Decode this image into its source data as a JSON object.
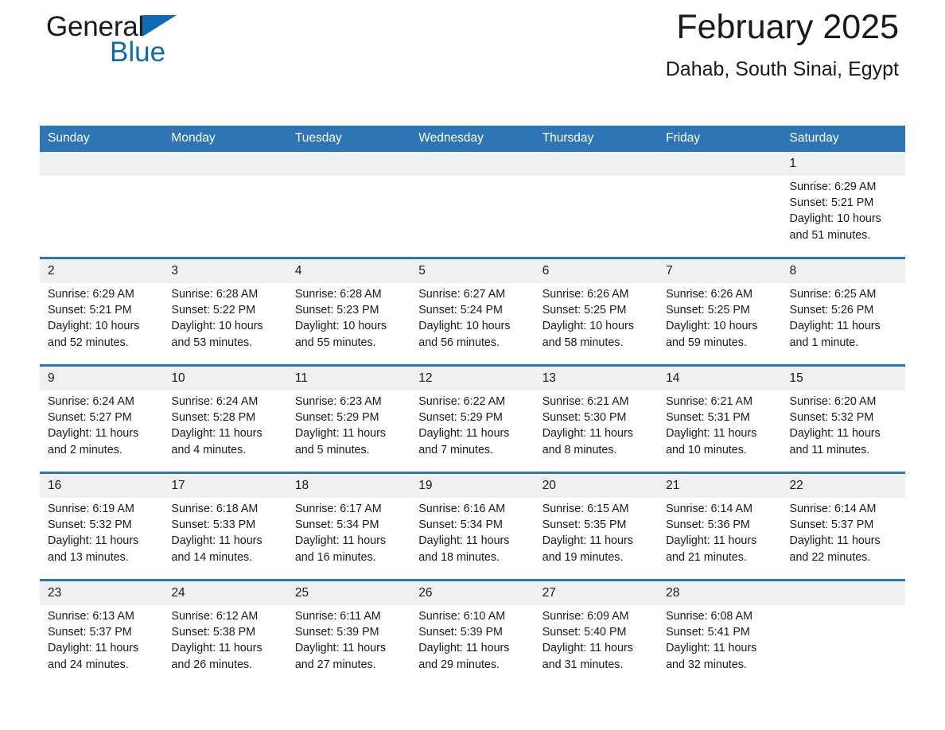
{
  "logo": {
    "word1": "General",
    "word2": "Blue",
    "triangle_color": "#1069b4",
    "triangle_icon": "triangle-icon"
  },
  "header": {
    "title": "February 2025",
    "subtitle": "Dahab, South Sinai, Egypt"
  },
  "colors": {
    "header_blue": "#2e75b6",
    "daynum_band": "#f0f0f0",
    "text": "#1a1a1a",
    "logo_blue": "#1069b4"
  },
  "calendar": {
    "weekday_headers": [
      "Sunday",
      "Monday",
      "Tuesday",
      "Wednesday",
      "Thursday",
      "Friday",
      "Saturday"
    ],
    "weeks": [
      [
        {
          "day": "",
          "sunrise": "",
          "sunset": "",
          "daylight": "",
          "empty": true
        },
        {
          "day": "",
          "sunrise": "",
          "sunset": "",
          "daylight": "",
          "empty": true
        },
        {
          "day": "",
          "sunrise": "",
          "sunset": "",
          "daylight": "",
          "empty": true
        },
        {
          "day": "",
          "sunrise": "",
          "sunset": "",
          "daylight": "",
          "empty": true
        },
        {
          "day": "",
          "sunrise": "",
          "sunset": "",
          "daylight": "",
          "empty": true
        },
        {
          "day": "",
          "sunrise": "",
          "sunset": "",
          "daylight": "",
          "empty": true
        },
        {
          "day": "1",
          "sunrise": "Sunrise: 6:29 AM",
          "sunset": "Sunset: 5:21 PM",
          "daylight": "Daylight: 10 hours and 51 minutes.",
          "empty": false
        }
      ],
      [
        {
          "day": "2",
          "sunrise": "Sunrise: 6:29 AM",
          "sunset": "Sunset: 5:21 PM",
          "daylight": "Daylight: 10 hours and 52 minutes.",
          "empty": false
        },
        {
          "day": "3",
          "sunrise": "Sunrise: 6:28 AM",
          "sunset": "Sunset: 5:22 PM",
          "daylight": "Daylight: 10 hours and 53 minutes.",
          "empty": false
        },
        {
          "day": "4",
          "sunrise": "Sunrise: 6:28 AM",
          "sunset": "Sunset: 5:23 PM",
          "daylight": "Daylight: 10 hours and 55 minutes.",
          "empty": false
        },
        {
          "day": "5",
          "sunrise": "Sunrise: 6:27 AM",
          "sunset": "Sunset: 5:24 PM",
          "daylight": "Daylight: 10 hours and 56 minutes.",
          "empty": false
        },
        {
          "day": "6",
          "sunrise": "Sunrise: 6:26 AM",
          "sunset": "Sunset: 5:25 PM",
          "daylight": "Daylight: 10 hours and 58 minutes.",
          "empty": false
        },
        {
          "day": "7",
          "sunrise": "Sunrise: 6:26 AM",
          "sunset": "Sunset: 5:25 PM",
          "daylight": "Daylight: 10 hours and 59 minutes.",
          "empty": false
        },
        {
          "day": "8",
          "sunrise": "Sunrise: 6:25 AM",
          "sunset": "Sunset: 5:26 PM",
          "daylight": "Daylight: 11 hours and 1 minute.",
          "empty": false
        }
      ],
      [
        {
          "day": "9",
          "sunrise": "Sunrise: 6:24 AM",
          "sunset": "Sunset: 5:27 PM",
          "daylight": "Daylight: 11 hours and 2 minutes.",
          "empty": false
        },
        {
          "day": "10",
          "sunrise": "Sunrise: 6:24 AM",
          "sunset": "Sunset: 5:28 PM",
          "daylight": "Daylight: 11 hours and 4 minutes.",
          "empty": false
        },
        {
          "day": "11",
          "sunrise": "Sunrise: 6:23 AM",
          "sunset": "Sunset: 5:29 PM",
          "daylight": "Daylight: 11 hours and 5 minutes.",
          "empty": false
        },
        {
          "day": "12",
          "sunrise": "Sunrise: 6:22 AM",
          "sunset": "Sunset: 5:29 PM",
          "daylight": "Daylight: 11 hours and 7 minutes.",
          "empty": false
        },
        {
          "day": "13",
          "sunrise": "Sunrise: 6:21 AM",
          "sunset": "Sunset: 5:30 PM",
          "daylight": "Daylight: 11 hours and 8 minutes.",
          "empty": false
        },
        {
          "day": "14",
          "sunrise": "Sunrise: 6:21 AM",
          "sunset": "Sunset: 5:31 PM",
          "daylight": "Daylight: 11 hours and 10 minutes.",
          "empty": false
        },
        {
          "day": "15",
          "sunrise": "Sunrise: 6:20 AM",
          "sunset": "Sunset: 5:32 PM",
          "daylight": "Daylight: 11 hours and 11 minutes.",
          "empty": false
        }
      ],
      [
        {
          "day": "16",
          "sunrise": "Sunrise: 6:19 AM",
          "sunset": "Sunset: 5:32 PM",
          "daylight": "Daylight: 11 hours and 13 minutes.",
          "empty": false
        },
        {
          "day": "17",
          "sunrise": "Sunrise: 6:18 AM",
          "sunset": "Sunset: 5:33 PM",
          "daylight": "Daylight: 11 hours and 14 minutes.",
          "empty": false
        },
        {
          "day": "18",
          "sunrise": "Sunrise: 6:17 AM",
          "sunset": "Sunset: 5:34 PM",
          "daylight": "Daylight: 11 hours and 16 minutes.",
          "empty": false
        },
        {
          "day": "19",
          "sunrise": "Sunrise: 6:16 AM",
          "sunset": "Sunset: 5:34 PM",
          "daylight": "Daylight: 11 hours and 18 minutes.",
          "empty": false
        },
        {
          "day": "20",
          "sunrise": "Sunrise: 6:15 AM",
          "sunset": "Sunset: 5:35 PM",
          "daylight": "Daylight: 11 hours and 19 minutes.",
          "empty": false
        },
        {
          "day": "21",
          "sunrise": "Sunrise: 6:14 AM",
          "sunset": "Sunset: 5:36 PM",
          "daylight": "Daylight: 11 hours and 21 minutes.",
          "empty": false
        },
        {
          "day": "22",
          "sunrise": "Sunrise: 6:14 AM",
          "sunset": "Sunset: 5:37 PM",
          "daylight": "Daylight: 11 hours and 22 minutes.",
          "empty": false
        }
      ],
      [
        {
          "day": "23",
          "sunrise": "Sunrise: 6:13 AM",
          "sunset": "Sunset: 5:37 PM",
          "daylight": "Daylight: 11 hours and 24 minutes.",
          "empty": false
        },
        {
          "day": "24",
          "sunrise": "Sunrise: 6:12 AM",
          "sunset": "Sunset: 5:38 PM",
          "daylight": "Daylight: 11 hours and 26 minutes.",
          "empty": false
        },
        {
          "day": "25",
          "sunrise": "Sunrise: 6:11 AM",
          "sunset": "Sunset: 5:39 PM",
          "daylight": "Daylight: 11 hours and 27 minutes.",
          "empty": false
        },
        {
          "day": "26",
          "sunrise": "Sunrise: 6:10 AM",
          "sunset": "Sunset: 5:39 PM",
          "daylight": "Daylight: 11 hours and 29 minutes.",
          "empty": false
        },
        {
          "day": "27",
          "sunrise": "Sunrise: 6:09 AM",
          "sunset": "Sunset: 5:40 PM",
          "daylight": "Daylight: 11 hours and 31 minutes.",
          "empty": false
        },
        {
          "day": "28",
          "sunrise": "Sunrise: 6:08 AM",
          "sunset": "Sunset: 5:41 PM",
          "daylight": "Daylight: 11 hours and 32 minutes.",
          "empty": false
        },
        {
          "day": "",
          "sunrise": "",
          "sunset": "",
          "daylight": "",
          "empty": true
        }
      ]
    ]
  }
}
